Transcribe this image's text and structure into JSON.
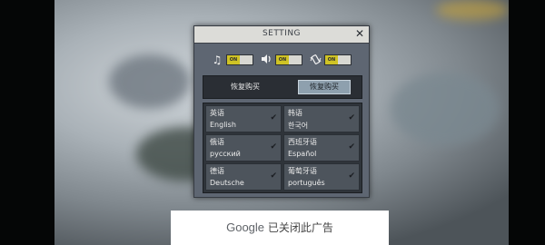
{
  "settings": {
    "title": "SETTING",
    "close": "✕",
    "toggles": [
      {
        "icon": "music-note",
        "state": "ON"
      },
      {
        "icon": "speaker",
        "state": "ON"
      },
      {
        "icon": "vibration",
        "state": "ON"
      }
    ],
    "restore_label": "恢复购买",
    "restore_button": "恢复购买",
    "languages": [
      {
        "zh": "英语",
        "native": "English",
        "selected": true
      },
      {
        "zh": "韩语",
        "native": "한국어",
        "selected": true
      },
      {
        "zh": "俄语",
        "native": "русский",
        "selected": true
      },
      {
        "zh": "西班牙语",
        "native": "Español",
        "selected": true
      },
      {
        "zh": "德语",
        "native": "Deutsche",
        "selected": true
      },
      {
        "zh": "葡萄牙语",
        "native": "português",
        "selected": true
      }
    ]
  },
  "ad": {
    "brand": "Google",
    "text": "已关闭此广告"
  }
}
